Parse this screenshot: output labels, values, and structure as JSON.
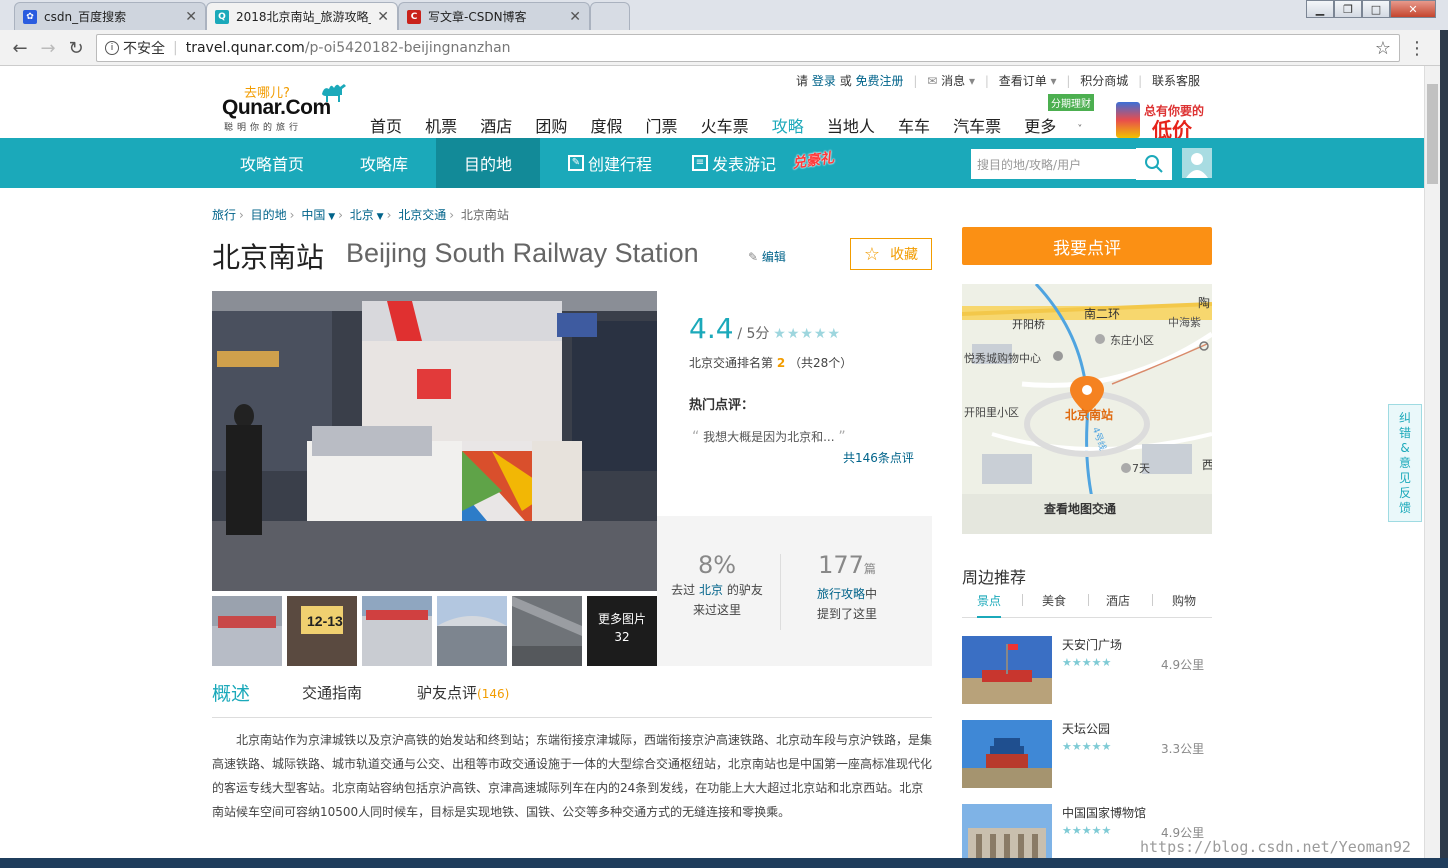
{
  "browser": {
    "tabs": [
      {
        "title": "csdn_百度搜索",
        "icon": "baidu-paw-icon",
        "color": "#2a5cdf"
      },
      {
        "title": "2018北京南站_旅游攻略_",
        "icon": "qunar-icon",
        "color": "#1ba9ba"
      },
      {
        "title": "写文章-CSDN博客",
        "icon": "csdn-icon",
        "color": "#c9221b"
      }
    ],
    "address": {
      "insecure_label": "不安全",
      "host": "travel.qunar.com",
      "path": "/p-oi5420182-beijingnanzhan"
    }
  },
  "header": {
    "logo_slogan": "去哪儿?",
    "logo_name": "Qunar.Com",
    "logo_tagline": "聪明你的旅行",
    "top_links": {
      "please": "请",
      "login": "登录",
      "or": "或",
      "register": "免费注册",
      "messages": "消息",
      "orders": "查看订单",
      "points_mall": "积分商城",
      "contact": "联系客服"
    },
    "nav": [
      "首页",
      "机票",
      "酒店",
      "团购",
      "度假",
      "门票",
      "火车票",
      "攻略",
      "当地人",
      "车车",
      "汽车票",
      "更多"
    ],
    "nav_active": "攻略",
    "fin_badge": "分期理财",
    "ad_line1": "总有你要的",
    "ad_line2": "低价"
  },
  "subnav": {
    "items": [
      "攻略首页",
      "攻略库",
      "目的地",
      "创建行程",
      "发表游记"
    ],
    "active": "目的地",
    "gift": "兑豪礼",
    "search_placeholder": "搜目的地/攻略/用户"
  },
  "breadcrumb": [
    "旅行",
    "目的地",
    "中国",
    "北京",
    "北京交通",
    "北京南站"
  ],
  "poi": {
    "name_cn": "北京南站",
    "name_en": "Beijing South Railway Station",
    "edit_label": "编辑",
    "favorite_label": "收藏",
    "score": "4.4",
    "score_of": "/ 5分",
    "rank_text": "北京交通排名第",
    "rank": "2",
    "rank_total": "（共28个）",
    "hot_review_label": "热门点评：",
    "hot_review": "我想大概是因为北京和...",
    "all_reviews": "共146条点评",
    "stat1_value": "8%",
    "stat1_pre": "去过",
    "stat1_link": "北京",
    "stat1_post": "的驴友",
    "stat1_line2": "来过这里",
    "stat2_value": "177",
    "stat2_unit": "篇",
    "stat2_link": "旅行攻略",
    "stat2_mid": "中",
    "stat2_line2": "提到了这里",
    "more_photos": "更多图片",
    "photo_count": "32"
  },
  "tabs": {
    "overview": "概述",
    "transport": "交通指南",
    "reviews": "驴友点评",
    "reviews_count": "(146)"
  },
  "description": "北京南站作为京津城铁以及京沪高铁的始发站和终到站；东端衔接京津城际，西端衔接京沪高速铁路、北京动车段与京沪铁路，是集高速铁路、城际铁路、城市轨道交通与公交、出租等市政交通设施于一体的大型综合交通枢纽站，北京南站也是中国第一座高标准现代化的客运专线大型客站。北京南站容纳包括京沪高铁、京津高速城际列车在内的24条到发线，在功能上大大超过北京站和北京西站。北京南站候车空间可容纳10500人同时候车，目标是实现地铁、国铁、公交等多种交通方式的无缝连接和零换乘。",
  "sidebar": {
    "review_button": "我要点评",
    "map": {
      "labels": [
        "开阳桥",
        "南二环",
        "陶",
        "中海紫",
        "东庄小区",
        "悦秀城购物中心",
        "北京南站",
        "开阳里小区",
        "7天",
        "西",
        "查看地图交通",
        "4号线"
      ]
    },
    "nearby_title": "周边推荐",
    "nearby_tabs": [
      "景点",
      "美食",
      "酒店",
      "购物"
    ],
    "nearby_active": "景点",
    "nearby": [
      {
        "name": "天安门广场",
        "distance": "4.9公里"
      },
      {
        "name": "天坛公园",
        "distance": "3.3公里"
      },
      {
        "name": "中国国家博物馆",
        "distance": "4.9公里"
      }
    ],
    "feedback": "纠错&意见反馈"
  },
  "watermark": "https://blog.csdn.net/Yeoman92"
}
